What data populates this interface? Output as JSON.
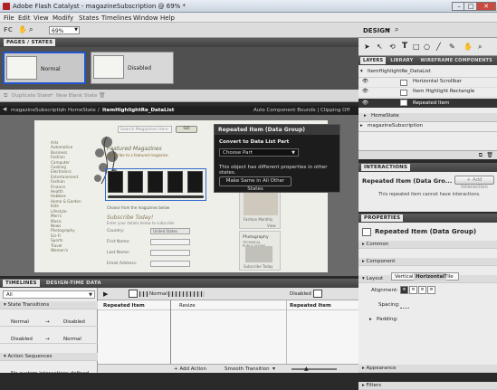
{
  "window": {
    "title": "Adobe Flash Catalyst - magazineSubscription @ 69% *"
  },
  "menu": [
    "File",
    "Edit",
    "View",
    "Modify",
    "States",
    "Timelines",
    "Window",
    "Help"
  ],
  "toolbar": {
    "zoom": "69%",
    "workspace": "DESIGN"
  },
  "pages": {
    "header": "PAGES / STATES",
    "states": [
      {
        "label": "Normal"
      },
      {
        "label": "Disabled"
      }
    ],
    "duplicate": "Duplicate State",
    "new_blank": "New Blank State"
  },
  "breadcrumb": {
    "items": [
      "magazineSubscription",
      "HomeState",
      "ItemHighlightRe_DataList"
    ],
    "right": "Auto Component Bounds | Clipping Off"
  },
  "site": {
    "search": "Search Magazines Here",
    "go": "GO",
    "nav": [
      "Arts",
      "Automotive",
      "Business",
      "Fashion",
      "Computer",
      "Cooking",
      "Electronics",
      "Entertainment",
      "Fashion",
      "Finance",
      "Health",
      "Hobbies",
      "Home & Garden",
      "Kids",
      "Lifestyle",
      "Men's",
      "Music",
      "News",
      "Photography",
      "Sci-Fi",
      "Sports",
      "Travel",
      "Women's"
    ],
    "featured_title": "Featured Magazines",
    "featured_sub": "Subscribe to a featured magazine",
    "choose_text": "Choose from the magazines below",
    "subscribe_title": "Subscribe Today!",
    "subscribe_sub": "Enter your details below to subscribe",
    "country_label": "Country:",
    "country_value": "United States",
    "first_label": "First Name:",
    "last_label": "Last Name:",
    "email_label": "Email Address:",
    "fashion_label": "Fashion Monthly",
    "view_label": "View",
    "photo_title": "Photography",
    "photo_sub": "TECHNICAL PUBLICATIONS",
    "right_subscribe": "Subscribe Today"
  },
  "popup": {
    "title": "Repeated Item (Data Group)",
    "convert_label": "Convert to Data List Part",
    "choose": "Choose Part",
    "message": "This object has different properties in other states.",
    "same_button": "Make Same in All Other States"
  },
  "timelines": {
    "tabs": [
      "TIMELINES",
      "DESIGN-TIME DATA"
    ],
    "filter": "All",
    "state_transitions": "State Transitions",
    "transitions": [
      {
        "from": "Normal",
        "to": "Disabled"
      },
      {
        "from": "Disabled",
        "to": "Normal"
      }
    ],
    "action_sequences": "Action Sequences",
    "no_interactions": "No custom interactions defined",
    "col_normal": "Normal",
    "col_disabled": "Disabled",
    "track_item": "Repeated Item",
    "track_resize": "Resize",
    "add_action": "+ Add Action",
    "smooth": "Smooth Transition"
  },
  "layers": {
    "tabs": [
      "LAYERS",
      "LIBRARY",
      "WIREFRAME COMPONENTS"
    ],
    "items": [
      {
        "label": "ItemHighlightRe_DataList",
        "indent": 0
      },
      {
        "label": "Horizontal Scrollbar",
        "indent": 2
      },
      {
        "label": "Item Highlight Rectangle",
        "indent": 2
      },
      {
        "label": "Repeated Item",
        "indent": 2,
        "selected": true
      },
      {
        "label": "HomeState",
        "indent": 1
      },
      {
        "label": "magazineSubscription",
        "indent": 0
      }
    ]
  },
  "interactions": {
    "header": "INTERACTIONS",
    "title": "Repeated Item (Data Gro...",
    "add": "+ Add Interaction",
    "message": "This repeated item cannot have interactions."
  },
  "properties": {
    "header": "PROPERTIES",
    "title": "Repeated Item (Data Group)",
    "sections": [
      "Common",
      "Component",
      "Layout"
    ],
    "layout_tabs": [
      "Vertical",
      "Horizontal",
      "Tile"
    ],
    "alignment": "Alignment:",
    "spacing": "Spacing:",
    "padding": "Padding:",
    "appearance": "Appearance",
    "filters": "Filters"
  }
}
